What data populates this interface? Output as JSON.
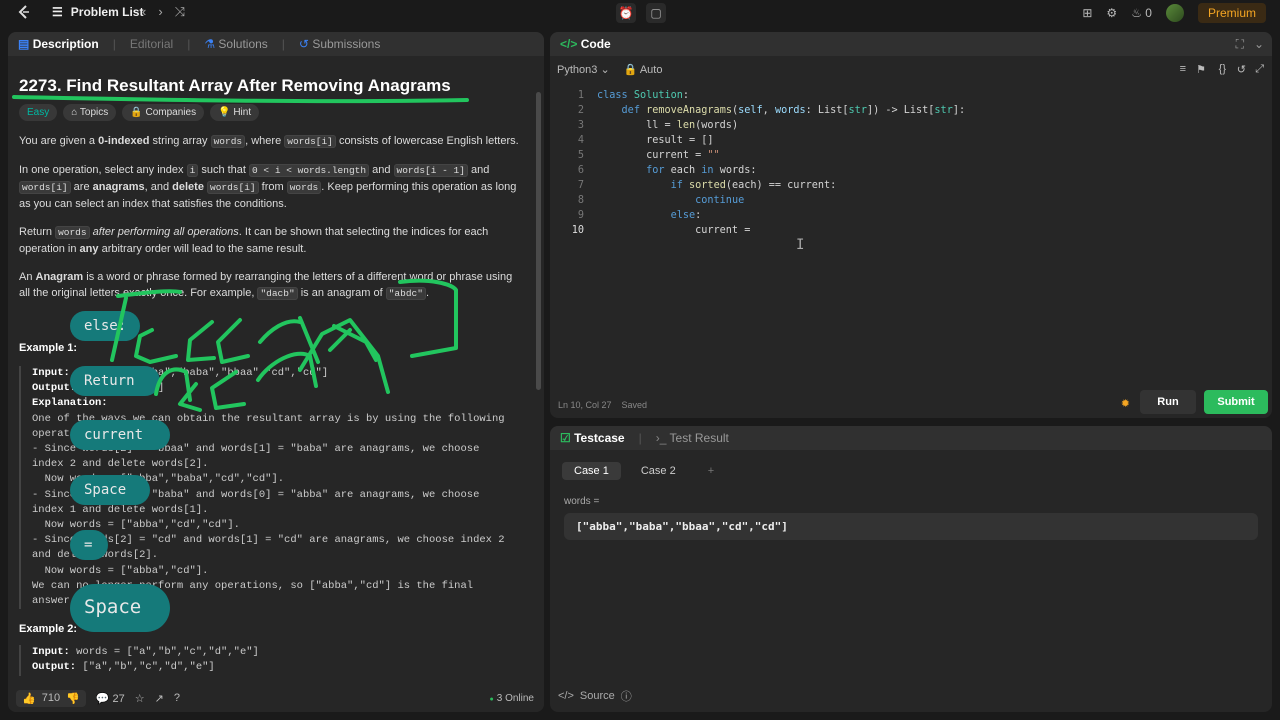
{
  "topbar": {
    "problem_list": "Problem List",
    "coins": "0",
    "premium": "Premium"
  },
  "left": {
    "tabs": [
      "Description",
      "Editorial",
      "Solutions",
      "Submissions"
    ],
    "title": "2273. Find Resultant Array After Removing Anagrams",
    "tags": [
      "Easy",
      "Topics",
      "Companies",
      "Hint"
    ],
    "p1": {
      "a": "You are given a ",
      "b": "0-indexed",
      "c": " string array ",
      "d": "words",
      "e": ", where ",
      "f": "words[i]",
      "g": " consists of lowercase English letters."
    },
    "p2": {
      "a": "In one operation, select any index ",
      "b": "i",
      "c": " such that ",
      "d": "0 < i < words.length",
      "e": " and ",
      "f": "words[i - 1]",
      "g": " and ",
      "h": "words[i]",
      "i": " are ",
      "j": "anagrams",
      "k": ", and ",
      "l": "delete",
      "m": " ",
      "n": "words[i]",
      "o": " from ",
      "p": "words",
      "q": ". Keep performing this operation as long as you can select an index that satisfies the conditions."
    },
    "p3": {
      "a": "Return ",
      "b": "words",
      "c": " ",
      "d": "after performing all operations",
      "e": ". It can be shown that selecting the indices for each operation in ",
      "f": "any",
      "g": " arbitrary order will lead to the same result."
    },
    "p4": {
      "a": "An ",
      "b": "Anagram",
      "c": " is a word or phrase formed by rearranging the letters of a different word or phrase using all the original letters exactly once. For example, ",
      "d": "\"dacb\"",
      "e": " is an anagram of ",
      "f": "\"abdc\"",
      "g": "."
    },
    "example1_heading": "Example 1:",
    "example1_lines": [
      "Input: words = [\"abba\",\"baba\",\"bbaa\",\"cd\",\"cd\"]",
      "Output: [\"abba\",\"cd\"]",
      "Explanation:",
      "One of the ways we can obtain the resultant array is by using the following",
      "operations:",
      "- Since words[2] = \"bbaa\" and words[1] = \"baba\" are anagrams, we choose",
      "index 2 and delete words[2].",
      "  Now words = [\"abba\",\"baba\",\"cd\",\"cd\"].",
      "- Since words[1] = \"baba\" and words[0] = \"abba\" are anagrams, we choose",
      "index 1 and delete words[1].",
      "  Now words = [\"abba\",\"cd\",\"cd\"].",
      "- Since words[2] = \"cd\" and words[1] = \"cd\" are anagrams, we choose index 2",
      "and delete words[2].",
      "  Now words = [\"abba\",\"cd\"].",
      "We can no longer perform any operations, so [\"abba\",\"cd\"] is the final",
      "answer."
    ],
    "example2_heading": "Example 2:",
    "example2_lines": [
      "Input: words = [\"a\",\"b\",\"c\",\"d\",\"e\"]",
      "Output: [\"a\",\"b\",\"c\",\"d\",\"e\"]"
    ],
    "likes": "710",
    "comments": "27",
    "online": "3 Online"
  },
  "annotations": [
    "else:",
    "Return",
    "current",
    "Space",
    "=",
    "Space"
  ],
  "code": {
    "tab": "Code",
    "language": "Python3",
    "mode": "Auto",
    "status_pos": "Ln 10, Col 27",
    "status_saved": "Saved",
    "run": "Run",
    "submit": "Submit"
  },
  "test": {
    "tabs": [
      "Testcase",
      "Test Result"
    ],
    "cases": [
      "Case 1",
      "Case 2",
      "+"
    ],
    "var_label": "words =",
    "var_value": "[\"abba\",\"baba\",\"bbaa\",\"cd\",\"cd\"]",
    "source": "Source"
  },
  "colors": {
    "accent_green": "#2cbb5d",
    "easy": "#00b8a3",
    "premium": "#f5a623",
    "annotation": "#22c55e",
    "bubble": "#157a7a"
  }
}
